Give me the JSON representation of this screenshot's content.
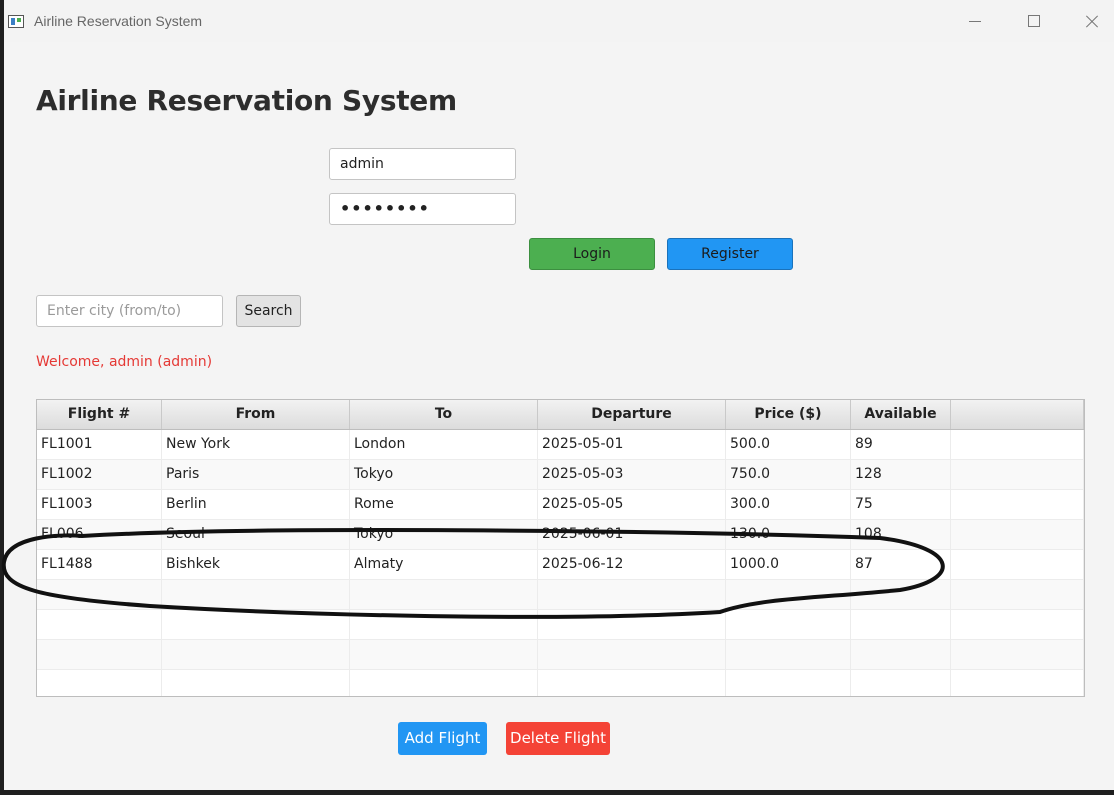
{
  "window": {
    "title": "Airline Reservation System"
  },
  "heading": "Airline Reservation System",
  "login": {
    "username_value": "admin",
    "password_mask": "••••••••",
    "login_label": "Login",
    "register_label": "Register"
  },
  "search": {
    "placeholder": "Enter city (from/to)",
    "button_label": "Search"
  },
  "welcome": "Welcome, admin (admin)",
  "table": {
    "columns": [
      "Flight #",
      "From",
      "To",
      "Departure",
      "Price ($)",
      "Available"
    ],
    "rows": [
      [
        "FL1001",
        "New York",
        "London",
        "2025-05-01",
        "500.0",
        "89"
      ],
      [
        "FL1002",
        "Paris",
        "Tokyo",
        "2025-05-03",
        "750.0",
        "128"
      ],
      [
        "FL1003",
        "Berlin",
        "Rome",
        "2025-05-05",
        "300.0",
        "75"
      ],
      [
        "FL006",
        "Seoul",
        "Tokyo",
        "2025-06-01",
        "130.0",
        "108"
      ],
      [
        "FL1488",
        "Bishkek",
        "Almaty",
        "2025-06-12",
        "1000.0",
        "87"
      ]
    ]
  },
  "actions": {
    "add_label": "Add Flight",
    "delete_label": "Delete Flight"
  },
  "colors": {
    "login": "#4caf50",
    "register": "#2196f3",
    "add": "#2196f3",
    "delete": "#f44336",
    "welcome": "#e53935"
  }
}
